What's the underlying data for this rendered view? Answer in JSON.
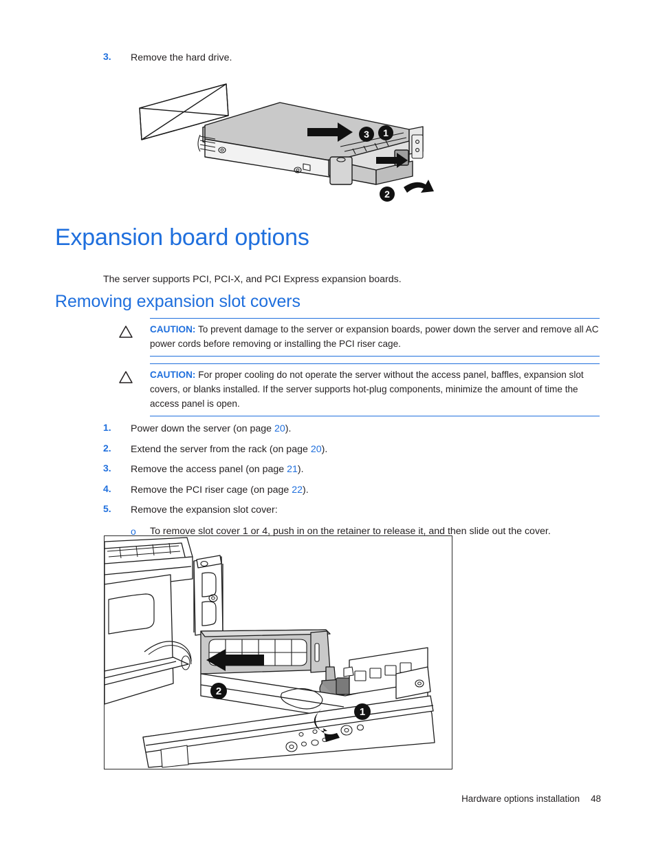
{
  "document": {
    "footer_section": "Hardware options installation",
    "page_number": "48"
  },
  "top_step": {
    "number": "3.",
    "text": "Remove the hard drive."
  },
  "figure_hdd": {
    "name": "hard-drive-removal-diagram",
    "callouts": [
      "1",
      "2",
      "3"
    ]
  },
  "headings": {
    "h1": "Expansion board options",
    "intro": "The server supports PCI, PCI-X, and PCI Express expansion boards.",
    "h2": "Removing expansion slot covers"
  },
  "cautions": [
    {
      "icon": "caution-triangle-icon",
      "label": "CAUTION:",
      "text": "To prevent damage to the server or expansion boards, power down the server and remove all AC power cords before removing or installing the PCI riser cage."
    },
    {
      "icon": "caution-triangle-icon",
      "label": "CAUTION:",
      "text": "For proper cooling do not operate the server without the access panel, baffles, expansion slot covers, or blanks installed. If the server supports hot-plug components, minimize the amount of time the access panel is open."
    }
  ],
  "steps": [
    {
      "number": "1.",
      "pre": "Power down the server (on page ",
      "link": "20",
      "post": ")."
    },
    {
      "number": "2.",
      "pre": "Extend the server from the rack (on page ",
      "link": "20",
      "post": ")."
    },
    {
      "number": "3.",
      "pre": "Remove the access panel (on page ",
      "link": "21",
      "post": ")."
    },
    {
      "number": "4.",
      "pre": "Remove the PCI riser cage (on page ",
      "link": "22",
      "post": ")."
    },
    {
      "number": "5.",
      "pre": "Remove the expansion slot cover:",
      "link": "",
      "post": ""
    }
  ],
  "sub_step": {
    "bullet": "o",
    "text": "To remove slot cover 1 or 4, push in on the retainer to release it, and then slide out the cover."
  },
  "figure_slot": {
    "name": "expansion-slot-cover-removal-diagram",
    "callouts": [
      "1",
      "2"
    ]
  },
  "colors": {
    "heading_blue": "#1f6fdd",
    "link_blue": "#1f6fdd",
    "body_black": "#231f20",
    "figure_border": "#2b2b2b",
    "figure_fill": "#c9c9c9"
  }
}
